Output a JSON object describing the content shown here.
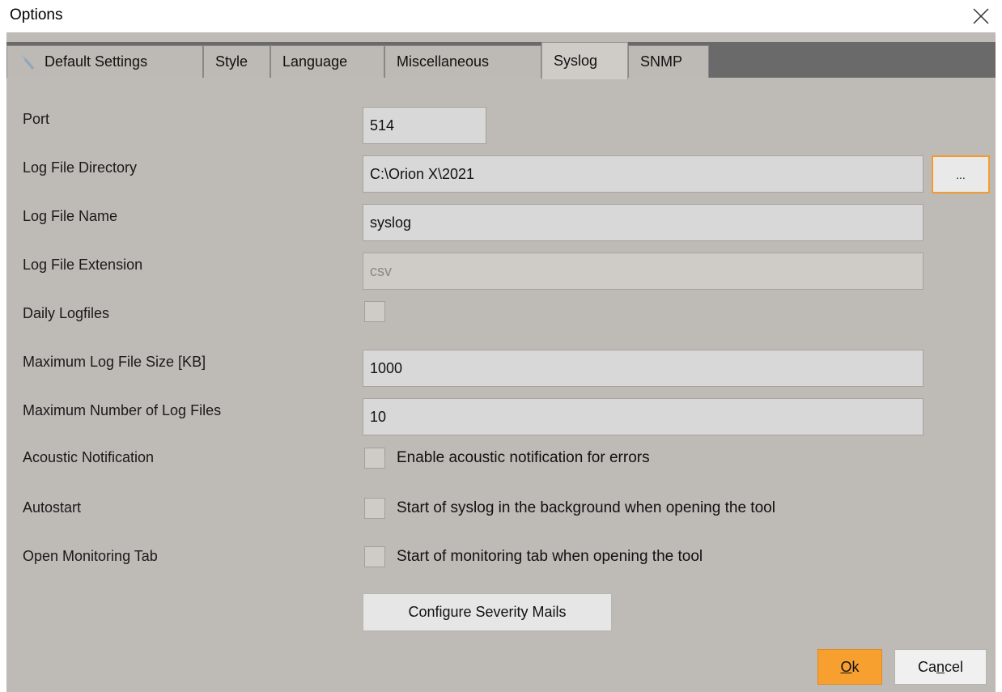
{
  "window": {
    "title": "Options"
  },
  "tabs": [
    {
      "label": "Default Settings"
    },
    {
      "label": "Style"
    },
    {
      "label": "Language"
    },
    {
      "label": "Miscellaneous"
    },
    {
      "label": "Syslog"
    },
    {
      "label": "SNMP"
    }
  ],
  "active_tab": "Syslog",
  "form": {
    "port": {
      "label": "Port",
      "value": "514"
    },
    "log_dir": {
      "label": "Log File Directory",
      "value": "C:\\Orion X\\2021",
      "browse_label": "..."
    },
    "log_name": {
      "label": "Log File Name",
      "value": "syslog"
    },
    "log_ext": {
      "label": "Log File Extension",
      "value": "csv"
    },
    "daily": {
      "label": "Daily Logfiles",
      "checked": false
    },
    "max_size": {
      "label": "Maximum Log File Size [KB]",
      "value": "1000"
    },
    "max_files": {
      "label": "Maximum Number of Log Files",
      "value": "10"
    },
    "acoustic": {
      "label": "Acoustic Notification",
      "checkbox_text": "Enable acoustic notification for errors",
      "checked": false
    },
    "autostart": {
      "label": "Autostart",
      "checkbox_text": "Start of syslog in the background when opening the tool",
      "checked": false
    },
    "monitoring": {
      "label": "Open Monitoring Tab",
      "checkbox_text": "Start of monitoring tab when opening the tool",
      "checked": false
    }
  },
  "buttons": {
    "configure": "Configure Severity Mails",
    "ok_mnemonic": "O",
    "ok_rest": "k",
    "cancel_pre": "Ca",
    "cancel_mnemonic": "n",
    "cancel_rest": "cel"
  },
  "colors": {
    "accent": "#f7a030",
    "panel": "#bebab6",
    "tabbar": "#6a6a6a"
  }
}
